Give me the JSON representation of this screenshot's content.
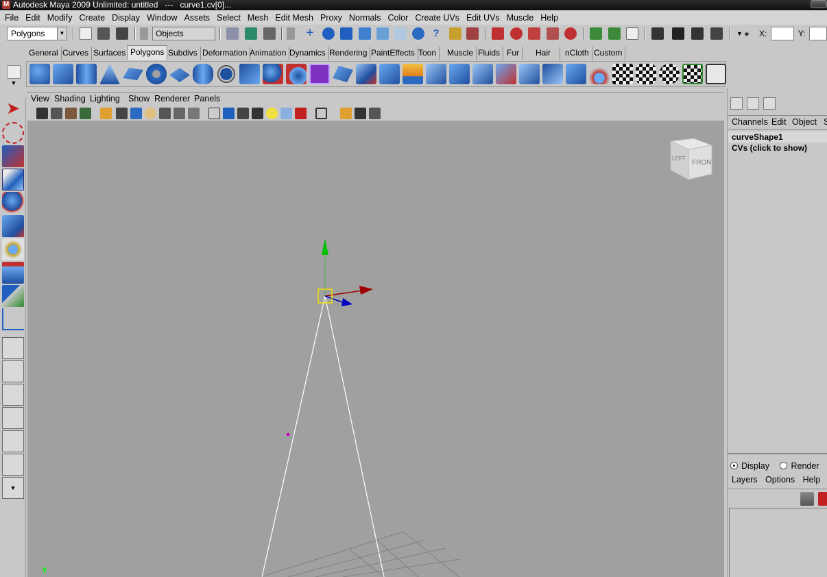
{
  "window": {
    "title": "Autodesk Maya 2009 Unlimited: untitled   ---   curve1.cv[0]..."
  },
  "menubar": [
    "File",
    "Edit",
    "Modify",
    "Create",
    "Display",
    "Window",
    "Assets",
    "Select",
    "Mesh",
    "Edit Mesh",
    "Proxy",
    "Normals",
    "Color",
    "Create UVs",
    "Edit UVs",
    "Muscle",
    "Help"
  ],
  "statusline": {
    "mode": "Polygons",
    "selection_field": "Objects",
    "x_label": "X:",
    "y_label": "Y:"
  },
  "shelf_tabs": [
    "General",
    "Curves",
    "Surfaces",
    "Polygons",
    "Subdivs",
    "Deformation",
    "Animation",
    "Dynamics",
    "Rendering",
    "PaintEffects",
    "Toon",
    "Muscle",
    "Fluids",
    "Fur",
    "Hair",
    "nCloth",
    "Custom"
  ],
  "active_shelf_tab": "Polygons",
  "panel_menu": [
    "View",
    "Shading",
    "Lighting",
    "Show",
    "Renderer",
    "Panels"
  ],
  "viewport": {
    "viewcube_face": "FRONT",
    "viewcube_side": "LEFT",
    "axis_indicator": "y",
    "background": "#a0a0a0"
  },
  "channel_box": {
    "menu": [
      "Channels",
      "Edit",
      "Object",
      "S"
    ],
    "shape_name": "curveShape1",
    "cvs_label": "CVs (click to show)"
  },
  "layer_editor": {
    "radio_options": [
      "Display",
      "Render",
      ""
    ],
    "selected": "Display",
    "menu": [
      "Layers",
      "Options",
      "Help"
    ]
  },
  "colors": {
    "accent_blue": "#1f5fbf",
    "selection_yellow": "#f0e000",
    "axis_x": "#c00000",
    "axis_y": "#00c000",
    "axis_z": "#0000c0"
  }
}
